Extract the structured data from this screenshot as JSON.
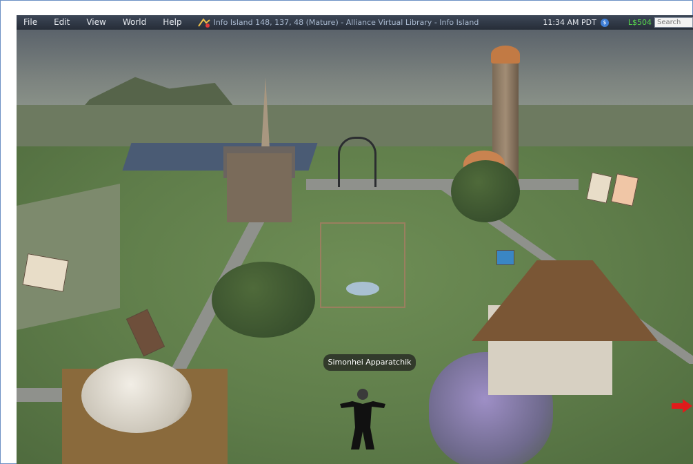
{
  "menu": {
    "items": [
      {
        "label": "File"
      },
      {
        "label": "Edit"
      },
      {
        "label": "View"
      },
      {
        "label": "World"
      },
      {
        "label": "Help"
      }
    ]
  },
  "location": {
    "text": "Info Island 148, 137, 48 (Mature) - Alliance Virtual Library - Info Island"
  },
  "status": {
    "time": "11:34 AM PDT",
    "balance": "L$504",
    "currency_icon_label": "$"
  },
  "search": {
    "placeholder": "Search"
  },
  "avatar": {
    "name": "Simonhei Apparatchik"
  },
  "colors": {
    "menubar": "#2f3744",
    "balance": "#58d84c",
    "ground": "#6e8d55"
  },
  "icons": {
    "location": "map-pin-icon",
    "currency": "linden-dollar-icon",
    "navigation": "red-arrow-icon"
  }
}
